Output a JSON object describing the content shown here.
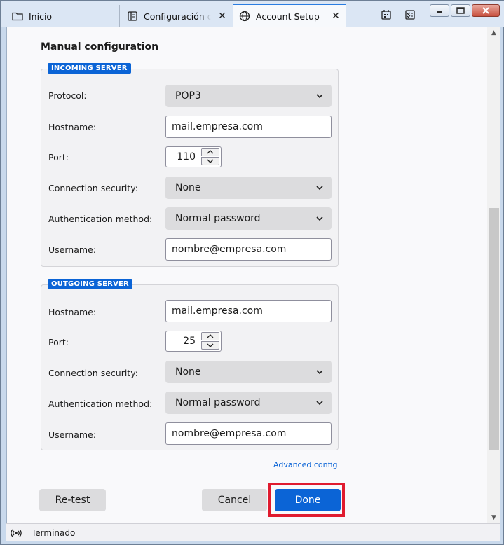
{
  "tabs": [
    {
      "label": "Inicio",
      "icon": "folder-icon"
    },
    {
      "label": "Configuración de la cuenta",
      "icon": "settings-page-icon"
    },
    {
      "label": "Account Setup",
      "icon": "globe-icon",
      "active": true
    }
  ],
  "toolbar": {
    "calendar_icon": "calendar-icon",
    "tasks_icon": "tasks-icon"
  },
  "section_title": "Manual configuration",
  "incoming": {
    "legend": "INCOMING SERVER",
    "protocol_label": "Protocol:",
    "protocol_value": "POP3",
    "hostname_label": "Hostname:",
    "hostname_value": "mail.empresa.com",
    "port_label": "Port:",
    "port_value": "110",
    "security_label": "Connection security:",
    "security_value": "None",
    "auth_label": "Authentication method:",
    "auth_value": "Normal password",
    "username_label": "Username:",
    "username_value": "nombre@empresa.com"
  },
  "outgoing": {
    "legend": "OUTGOING SERVER",
    "hostname_label": "Hostname:",
    "hostname_value": "mail.empresa.com",
    "port_label": "Port:",
    "port_value": "25",
    "security_label": "Connection security:",
    "security_value": "None",
    "auth_label": "Authentication method:",
    "auth_value": "Normal password",
    "username_label": "Username:",
    "username_value": "nombre@empresa.com"
  },
  "advanced_link": "Advanced config",
  "buttons": {
    "retest": "Re-test",
    "cancel": "Cancel",
    "done": "Done"
  },
  "status": {
    "text": "Terminado"
  },
  "colors": {
    "accent": "#0b64d6",
    "highlight": "#e01b2f"
  }
}
